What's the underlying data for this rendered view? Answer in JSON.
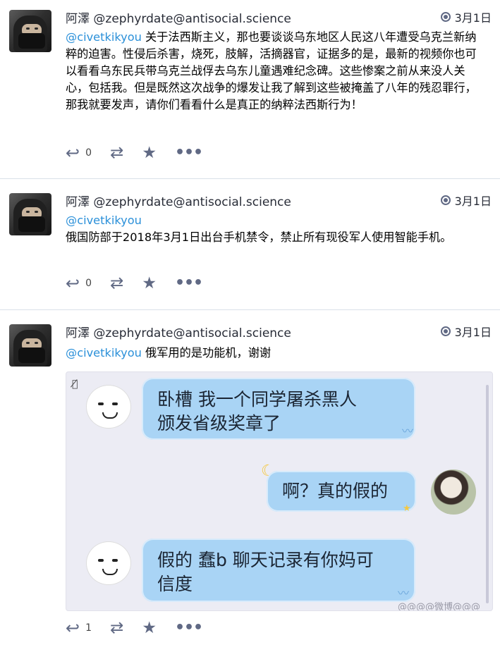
{
  "statuses": [
    {
      "display_name": "阿澤",
      "acct": "@zephyrdate@antisocial.science",
      "time": "3月1日",
      "mention": "@civetkikyou",
      "text": " 关于法西斯主义，那也要谈谈乌东地区人民这八年遭受乌克兰新纳粹的迫害。性侵后杀害，烧死，肢解，活摘器官，证据多的是，最新的视频你也可以看看乌东民兵带乌克兰战俘去乌东儿童遇难纪念碑。这些惨案之前从来没人关心，包括我。但是既然这次战争的爆发让我了解到这些被掩盖了八年的残忍罪行，那我就要发声，请你们看看什么是真正的纳粹法西斯行为！",
      "reply_count": "0"
    },
    {
      "display_name": "阿澤",
      "acct": "@zephyrdate@antisocial.science",
      "time": "3月1日",
      "mention": "@civetkikyou",
      "text": "俄国防部于2018年3月1日出台手机禁令，禁止所有现役军人使用智能手机。",
      "reply_count": "0"
    },
    {
      "display_name": "阿澤",
      "acct": "@zephyrdate@antisocial.science",
      "time": "3月1日",
      "mention": "@civetkikyou",
      "text": " 俄军用的是功能机，谢谢",
      "reply_count": "1",
      "media": {
        "bubble1_line1": "卧槽 我一个同学屠杀黑人",
        "bubble1_line2": "颁发省级奖章了",
        "bubble2": "啊？真的假的",
        "bubble3_line1": "假的 蠢b 聊天记录有你妈可",
        "bubble3_line2": "信度",
        "watermark": "@@@@微博@@@"
      }
    }
  ],
  "icons": {
    "reply": "reply-icon",
    "boost": "boost-icon",
    "favourite": "star-icon",
    "more": "more-icon",
    "visibility": "globe-icon",
    "hide_media": "eye-slash-icon"
  },
  "colors": {
    "mention": "#2b90d9",
    "action": "#606984",
    "bubble": "#a9d4f5",
    "divider": "#d9e1e8"
  }
}
